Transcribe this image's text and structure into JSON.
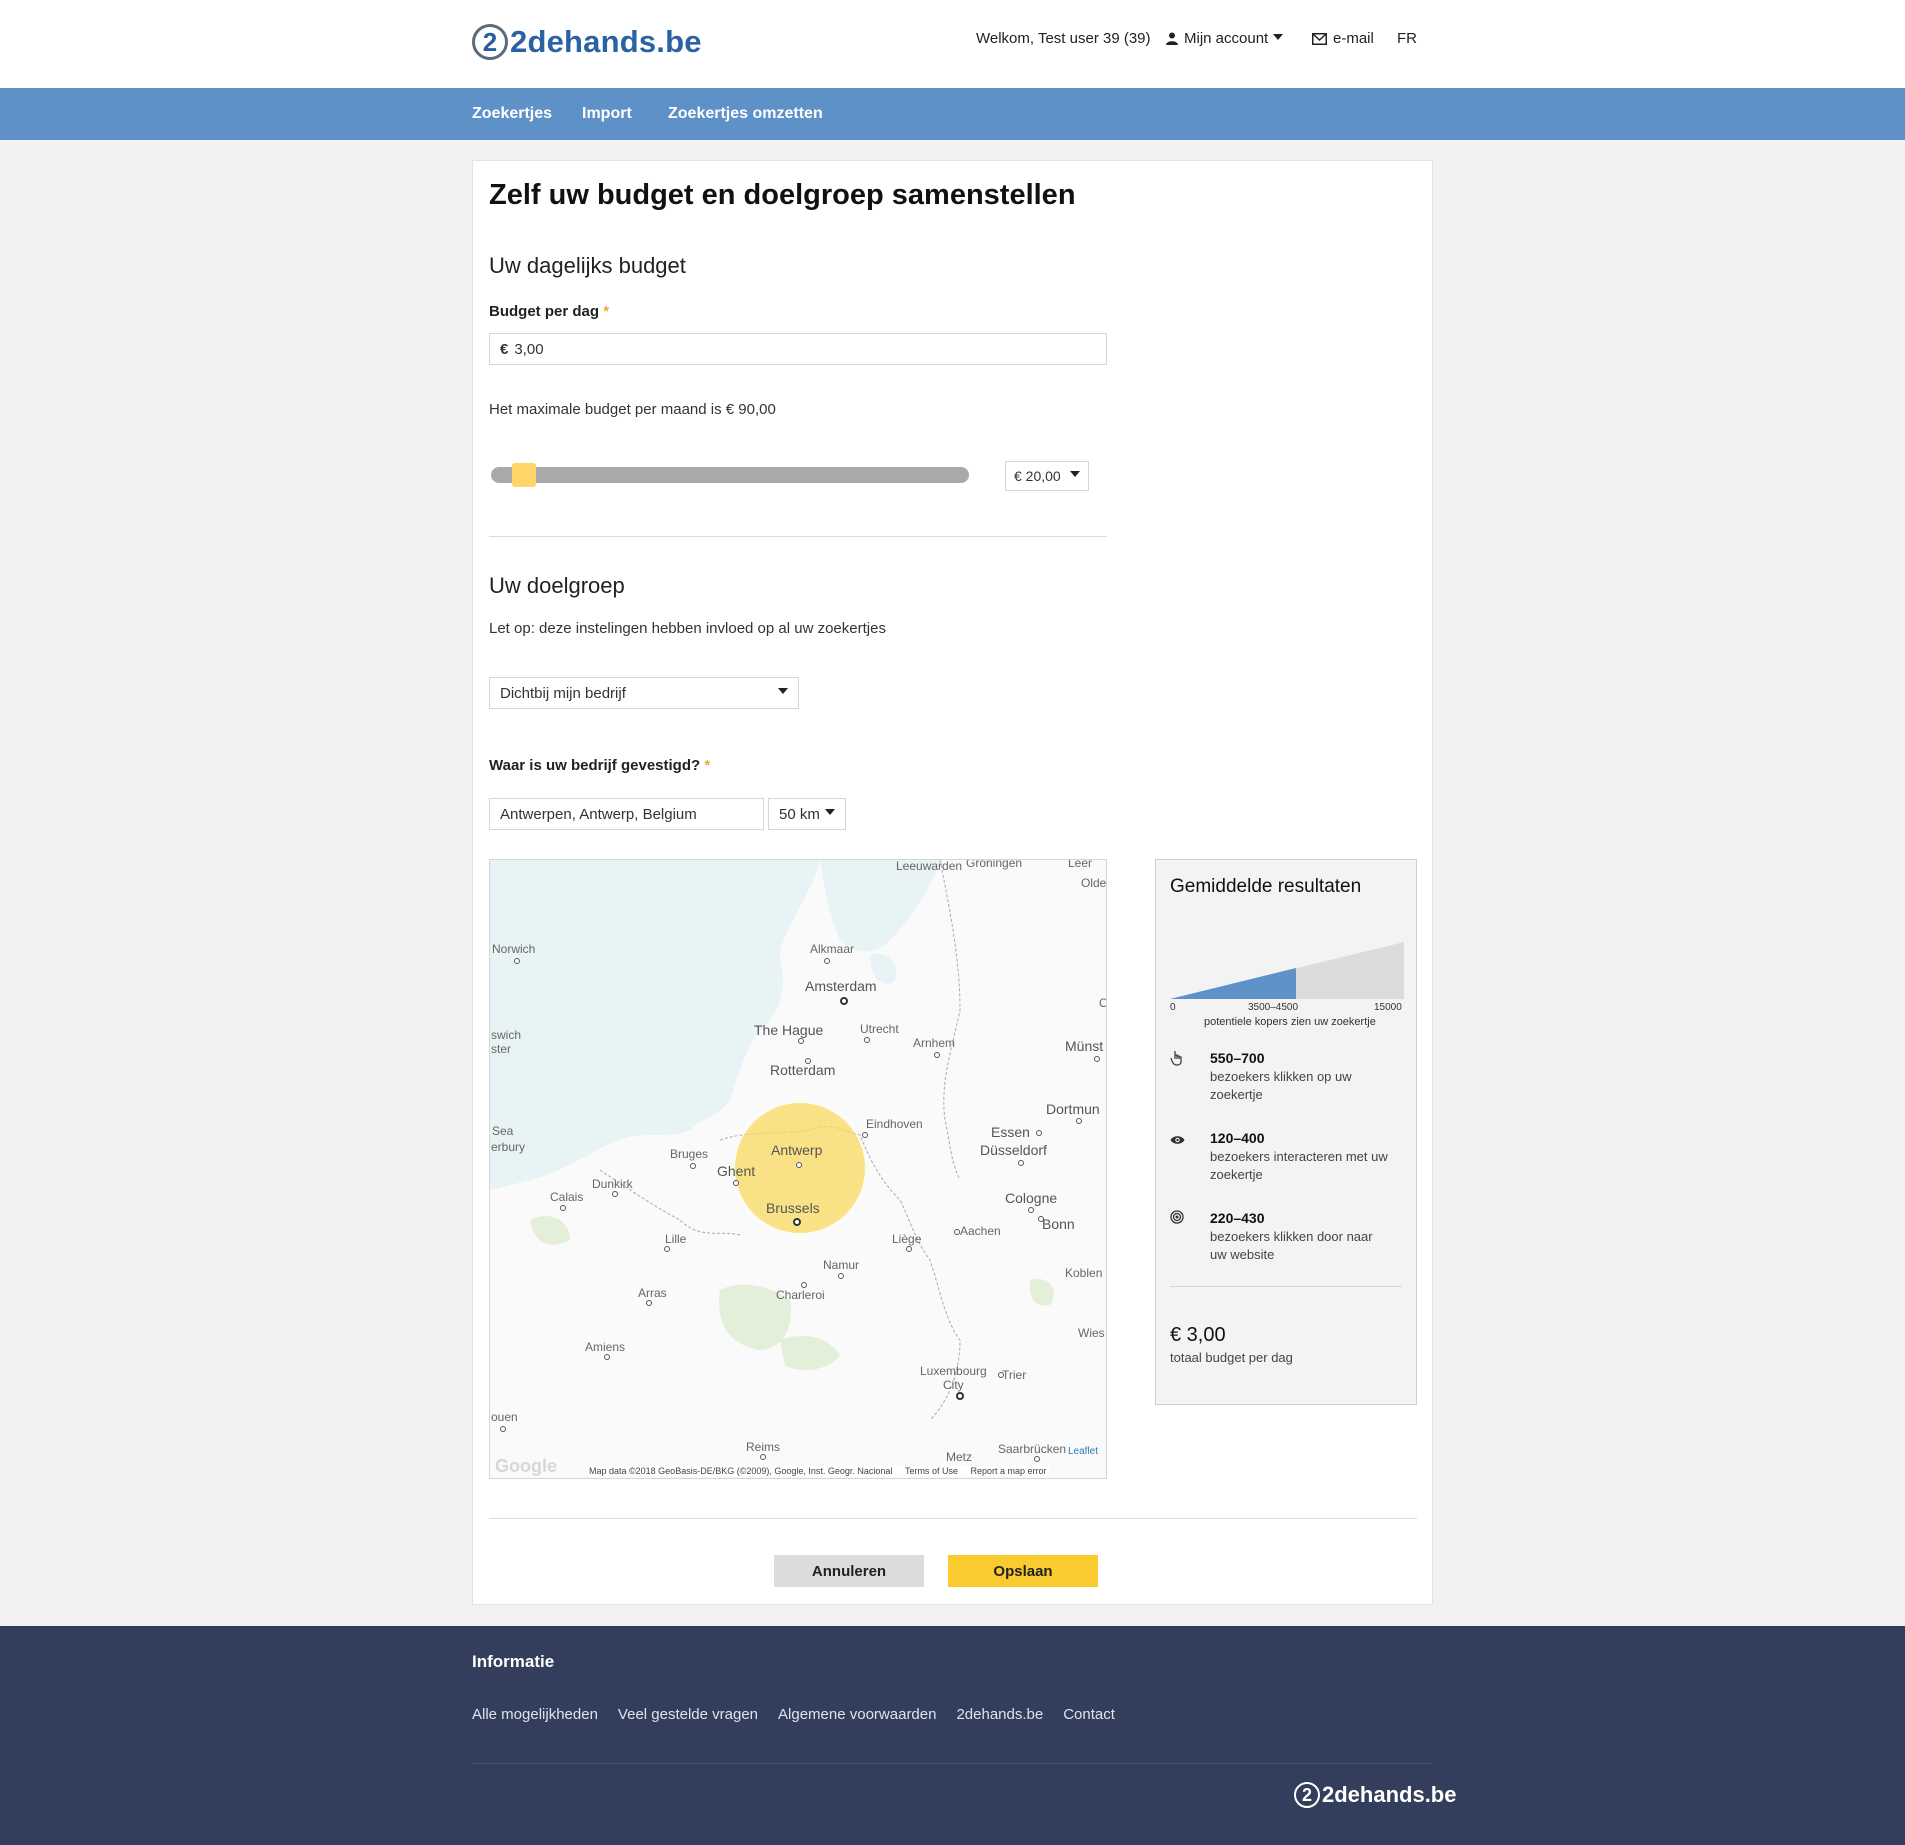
{
  "header": {
    "logo_text": "2dehands.be",
    "logo_mark": "2",
    "welcome": "Welkom, Test user 39 (39)",
    "account": "Mijn account",
    "email": "e-mail",
    "lang": "FR"
  },
  "nav": {
    "items": [
      "Zoekertjes",
      "Import",
      "Zoekertjes omzetten"
    ]
  },
  "page": {
    "title": "Zelf uw budget en doelgroep samenstellen",
    "budget_heading": "Uw dagelijks budget",
    "budget_label": "Budget per dag",
    "required_mark": "*",
    "currency": "€",
    "budget_value": "3,00",
    "max_budget_text": "Het maximale budget per maand is € 90,00",
    "slider_max": "€ 20,00",
    "slider_level": 0.05,
    "audience_heading": "Uw doelgroep",
    "audience_note": "Let op: deze instelingen hebben invloed op al uw zoekertjes",
    "audience_select": "Dichtbij mijn bedrijf",
    "location_label": "Waar is uw bedrijf gevestigd?",
    "location_value": "Antwerpen, Antwerp, Belgium",
    "radius": "50 km"
  },
  "map": {
    "labels": [
      "Leeuwarden",
      "Groningen",
      "Leer",
      "Olde",
      "Norwich",
      "Alkmaar",
      "Amsterdam",
      "O",
      "swich",
      "ster",
      "The Hague",
      "Utrecht",
      "Arnhem",
      "Münst",
      "Rotterdam",
      "Dortmun",
      "Sea",
      "erbury",
      "Eindhoven",
      "Essen",
      "Antwerp",
      "Düsseldorf",
      "Bruges",
      "Ghent",
      "Dunkirk",
      "Calais",
      "Cologne",
      "Brussels",
      "Bonn",
      "Lille",
      "Aachen",
      "Liège",
      "Namur",
      "Koblen",
      "Arras",
      "Charleroi",
      "Wies",
      "Amiens",
      "Luxembourg",
      "City",
      "Trier",
      "ouen",
      "Reims",
      "Saarbrücken",
      "Metz"
    ],
    "attribution": "Map data ©2018 GeoBasis-DE/BKG (©2009), Google, Inst. Geogr. Nacional",
    "terms": "Terms of Use",
    "report": "Report a map error",
    "leaflet": "Leaflet",
    "google": "Google"
  },
  "results": {
    "title": "Gemiddelde resultaten",
    "chart": {
      "min": "0",
      "range": "3500–4500",
      "max": "15000",
      "caption": "potentiele kopers zien uw zoekertje"
    },
    "metrics": [
      {
        "icon": "hand-pointer-icon",
        "num": "550–700",
        "desc": "bezoekers klikken op uw zoekertje"
      },
      {
        "icon": "eye-icon",
        "num": "120–400",
        "desc": "bezoekers interacteren met uw zoekertje"
      },
      {
        "icon": "target-icon",
        "num": "220–430",
        "desc": "bezoekers klikken door naar uw website"
      }
    ],
    "total": "€ 3,00",
    "total_label": "totaal budget per dag"
  },
  "buttons": {
    "cancel": "Annuleren",
    "save": "Opslaan"
  },
  "footer": {
    "title": "Informatie",
    "links": [
      "Alle mogelijkheden",
      "Veel gestelde vragen",
      "Algemene voorwaarden",
      "2dehands.be",
      "Contact"
    ],
    "logo_text": "2dehands.be"
  },
  "colors": {
    "accent_blue": "#5f91c9",
    "yellow": "#f9cb2e",
    "footer_bg": "#333e5c"
  }
}
